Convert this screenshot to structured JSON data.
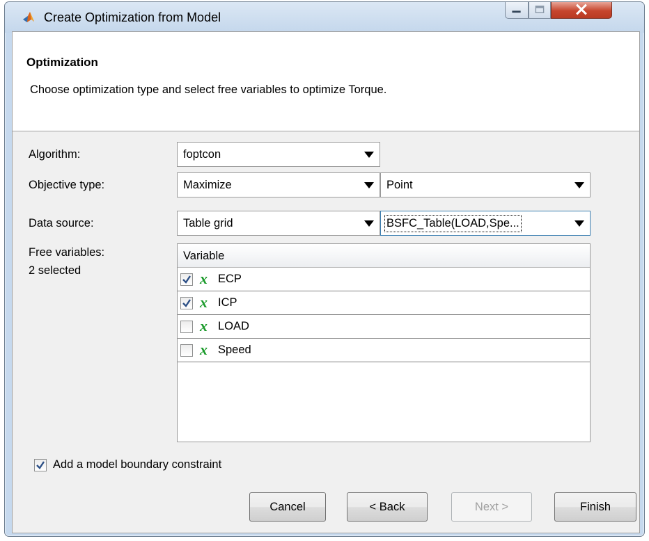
{
  "window": {
    "title": "Create Optimization from Model",
    "controls": [
      "minimize-icon",
      "maximize-icon",
      "close-icon"
    ]
  },
  "header": {
    "title": "Optimization",
    "description": "Choose optimization type and select free variables to optimize Torque."
  },
  "form": {
    "algorithm_label": "Algorithm:",
    "algorithm_value": "foptcon",
    "objective_label": "Objective type:",
    "objective_value": "Maximize",
    "objective_mode_value": "Point",
    "datasource_label": "Data source:",
    "datasource_value": "Table grid",
    "datasource_table_value": "BSFC_Table(LOAD,Spe...",
    "freevars_label": "Free variables:",
    "freevars_count": "2 selected"
  },
  "variables": {
    "column_header": "Variable",
    "symbol": "x",
    "rows": [
      {
        "name": "ECP",
        "checked": true
      },
      {
        "name": "ICP",
        "checked": true
      },
      {
        "name": "LOAD",
        "checked": false
      },
      {
        "name": "Speed",
        "checked": false
      }
    ]
  },
  "boundary": {
    "label": "Add a model boundary constraint",
    "checked": true
  },
  "buttons": {
    "cancel": "Cancel",
    "back": "< Back",
    "next": "Next >",
    "finish": "Finish"
  },
  "colors": {
    "variable_symbol": "#1a9a2a",
    "close_button": "#c6452d",
    "titlebar": "#c4d7ec"
  }
}
